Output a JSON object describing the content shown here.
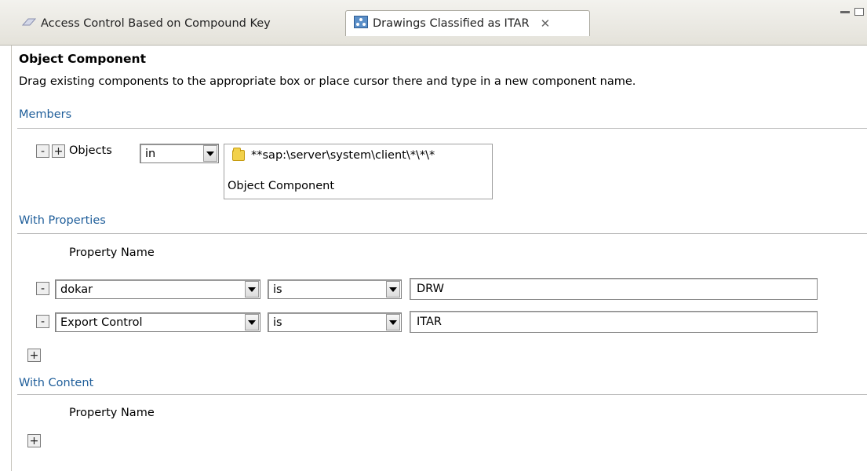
{
  "tabs": [
    {
      "label": "Access Control Based on Compound Key",
      "icon": "access-control-icon",
      "active": false
    },
    {
      "label": "Drawings Classified as ITAR",
      "icon": "rule-icon",
      "active": true,
      "closable": true
    }
  ],
  "form": {
    "title": "Object Component",
    "description": "Drag existing components to the appropriate box or place cursor there and type in a new component name.",
    "members": {
      "section_label": "Members",
      "minus_label": "-",
      "plus_label": "+",
      "objects_label": "Objects",
      "operator": "in",
      "object_path": "**sap:\\server\\system\\client\\*\\*\\*",
      "object_type": "Object Component"
    },
    "properties": {
      "section_label": "With Properties",
      "column_header": "Property Name",
      "rows": [
        {
          "remove_label": "-",
          "property": "dokar",
          "operator": "is",
          "value": "DRW"
        },
        {
          "remove_label": "-",
          "property": "Export Control",
          "operator": "is",
          "value": "ITAR"
        }
      ],
      "add_label": "+"
    },
    "content": {
      "section_label": "With Content",
      "column_header": "Property Name",
      "add_label": "+"
    }
  },
  "colors": {
    "section_link": "#1f5e9a",
    "tab_strip": "#e4e2da",
    "background": "#ffffff"
  }
}
